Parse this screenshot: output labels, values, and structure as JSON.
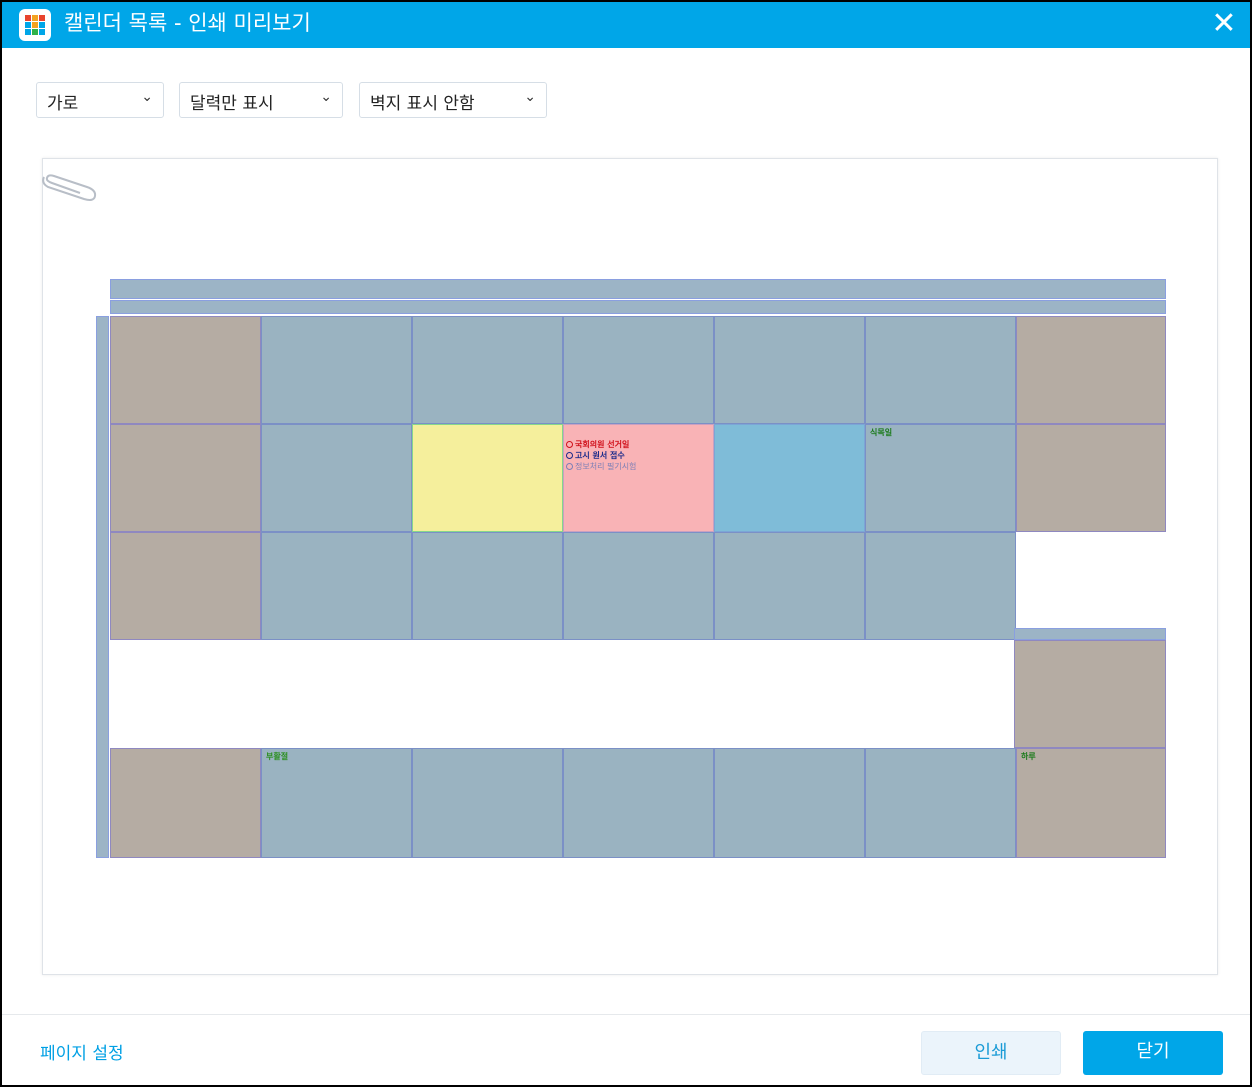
{
  "window": {
    "title": "캘린더 목록 - 인쇄 미리보기",
    "icon": "app-grid-icon",
    "close_icon": "close-icon"
  },
  "toolbar": {
    "orientation": "가로",
    "display_mode": "달력만 표시",
    "wallpaper": "벽지 표시 안함"
  },
  "preview": {
    "clip_icon": "paperclip-icon",
    "events": {
      "red": "국회의원 선거일",
      "navy": "고시 원서 접수",
      "gray": "정보처리 필기시험"
    },
    "day_labels": {
      "green1": "식목일",
      "green2": "부활절",
      "green3": "하루"
    }
  },
  "footer": {
    "page_setup": "페이지 설정",
    "print": "인쇄",
    "close": "닫기"
  },
  "colors": {
    "accent": "#00a6e8",
    "weekend_cell": "#b5aca3",
    "weekday_cell": "#9ab3c1",
    "highlight_yellow": "#f5ef9c",
    "highlight_pink": "#f9b3b6",
    "highlight_blue": "#7fbcd8"
  }
}
